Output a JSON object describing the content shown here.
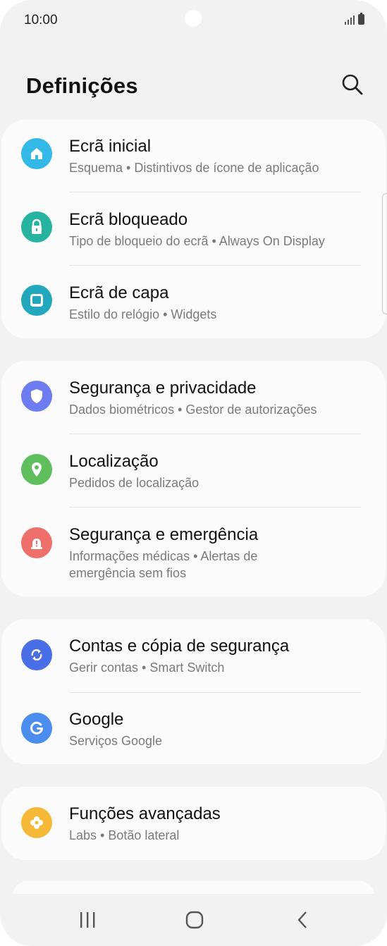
{
  "status_bar": {
    "time": "10:00"
  },
  "header": {
    "title": "Definições"
  },
  "groups": [
    {
      "items": [
        {
          "label": "Ecrã inicial",
          "subtitle": "Esquema  •  Distintivos de ícone de aplicação",
          "icon": "home-icon",
          "color": "#34b8e8"
        },
        {
          "label": "Ecrã bloqueado",
          "subtitle": "Tipo de bloqueio do ecrã  •  Always On Display",
          "icon": "lock-icon",
          "color": "#26b3a0"
        },
        {
          "label": "Ecrã de capa",
          "subtitle": "Estilo do relógio  •  Widgets",
          "icon": "cover-screen-icon",
          "color": "#22a8bd"
        }
      ]
    },
    {
      "items": [
        {
          "label": "Segurança e privacidade",
          "subtitle": "Dados biométricos  •  Gestor de autorizações",
          "icon": "shield-icon",
          "color": "#6d7cf0"
        },
        {
          "label": "Localização",
          "subtitle": "Pedidos de localização",
          "icon": "location-pin-icon",
          "color": "#5fbf5d"
        },
        {
          "label": "Segurança e emergência",
          "subtitle": "Informações médicas  •  Alertas de emergência sem fios",
          "icon": "emergency-icon",
          "color": "#ef6f6a"
        }
      ]
    },
    {
      "items": [
        {
          "label": "Contas e cópia de segurança",
          "subtitle": "Gerir contas  •  Smart Switch",
          "icon": "sync-icon",
          "color": "#4a6ee8"
        },
        {
          "label": "Google",
          "subtitle": "Serviços Google",
          "icon": "google-icon",
          "color": "#4c8df0"
        }
      ]
    },
    {
      "items": [
        {
          "label": "Funções avançadas",
          "subtitle": "Labs  •  Botão lateral",
          "icon": "puzzle-icon",
          "color": "#f5b937"
        }
      ]
    }
  ]
}
